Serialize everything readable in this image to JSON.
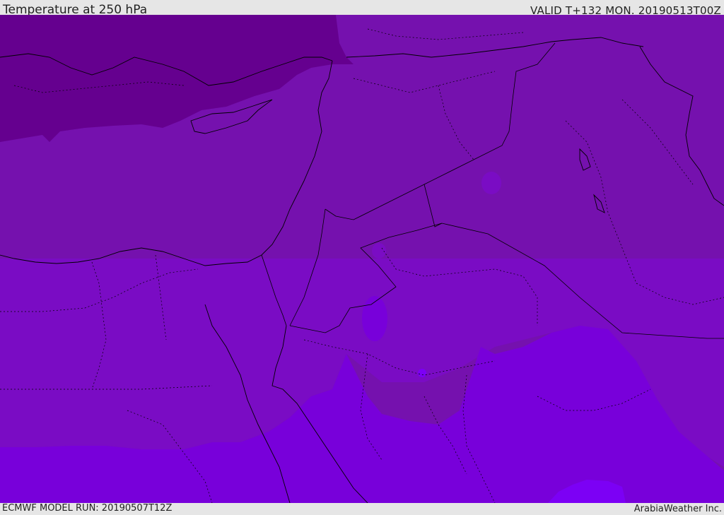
{
  "header": {
    "title": "Temperature at 250 hPa",
    "valid": "VALID T+132 MON. 20190513T00Z"
  },
  "footer": {
    "model_run": "ECMWF MODEL RUN: 20190507T12Z",
    "credit": "ArabiaWeather Inc."
  },
  "map": {
    "colors": {
      "coldest": "#65008f",
      "base": "#7511ae",
      "mid": "#7a0cc4",
      "warm": "#7800da",
      "warmest": "#7c00f5",
      "border": "#000000"
    }
  }
}
